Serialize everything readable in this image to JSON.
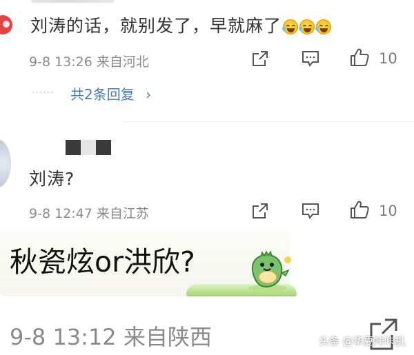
{
  "comment1": {
    "text": "刘涛的话，就别发了，早就麻了",
    "emoji_icons": [
      "crying-laughing-emoji",
      "crying-laughing-emoji",
      "crying-laughing-emoji"
    ],
    "meta": "9-8 13:26  来自河北",
    "like_count": "10",
    "replies_label": "共2条回复",
    "replies_chevron": "›"
  },
  "comment2": {
    "text": "刘涛?",
    "meta": "9-8 12:47  来自江苏",
    "like_count": "10"
  },
  "comment3": {
    "sticker_text": "秋瓷炫or洪欣?",
    "meta": "9-8 13:12  来自陕西"
  },
  "watermark": "头条 @华夏咔咔机",
  "colors": {
    "text": "#333333",
    "meta": "#8a8a8a",
    "link": "#4a7bb5",
    "badge": "#e64340"
  },
  "icons": {
    "share": "share-icon",
    "comment": "comment-icon",
    "like": "thumbs-up-icon"
  }
}
